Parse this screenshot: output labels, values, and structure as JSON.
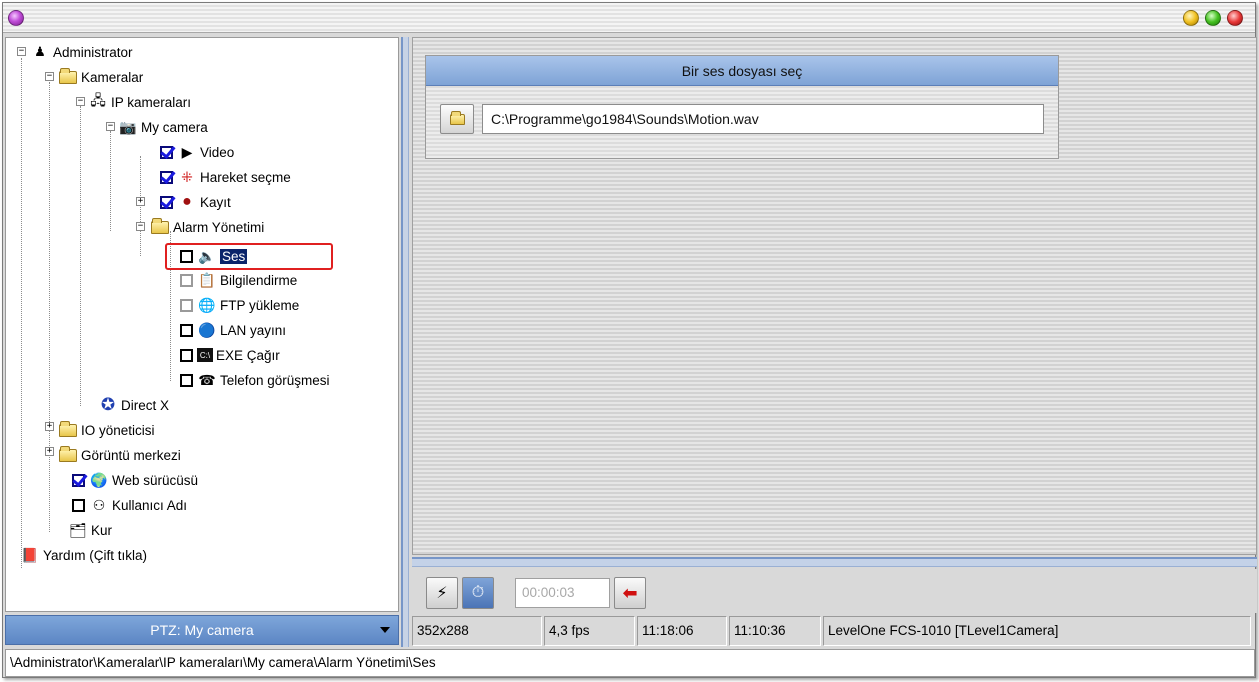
{
  "colors": {
    "accent": "#7ea3d6",
    "selection": "#0a246a",
    "highlight_box": "#e02020"
  },
  "tree": {
    "items": [
      {
        "label": "Administrator",
        "icon": "user-icon"
      },
      {
        "label": "Kameralar",
        "icon": "folder-icon"
      },
      {
        "label": "IP kameraları",
        "icon": "ip-camera-icon"
      },
      {
        "label": "My camera",
        "icon": "camera-icon"
      },
      {
        "label": "Video",
        "icon": "play-icon",
        "checked": true
      },
      {
        "label": "Hareket seçme",
        "icon": "motion-icon",
        "checked": true
      },
      {
        "label": "Kayıt",
        "icon": "record-icon",
        "checked": true
      },
      {
        "label": "Alarm Yönetimi",
        "icon": "folder-icon"
      },
      {
        "label": "Ses",
        "icon": "speaker-icon",
        "checked": false,
        "selected": true
      },
      {
        "label": "Bilgilendirme",
        "icon": "notify-icon",
        "checked": false
      },
      {
        "label": "FTP yükleme",
        "icon": "ftp-icon",
        "checked": false
      },
      {
        "label": "LAN yayını",
        "icon": "lan-icon",
        "checked": false
      },
      {
        "label": "EXE Çağır",
        "icon": "exe-icon",
        "checked": false
      },
      {
        "label": "Telefon görüşmesi",
        "icon": "phone-icon",
        "checked": false
      },
      {
        "label": "Direct X",
        "icon": "directx-icon"
      },
      {
        "label": "IO yöneticisi",
        "icon": "folder-icon"
      },
      {
        "label": "Görüntü merkezi",
        "icon": "folder-icon"
      },
      {
        "label": "Web sürücüsü",
        "icon": "globe-icon",
        "checked": true
      },
      {
        "label": "Kullanıcı Adı",
        "icon": "users-icon",
        "checked": false
      },
      {
        "label": "Kur",
        "icon": "setup-icon"
      },
      {
        "label": "Yardım (Çift tıkla)",
        "icon": "help-book-icon"
      }
    ]
  },
  "ptz": {
    "label": "PTZ: My camera"
  },
  "sound_panel": {
    "title": "Bir ses dosyası seç",
    "path_value": "C:\\Programme\\go1984\\Sounds\\Motion.wav"
  },
  "toolbar": {
    "time_value": "00:00:03"
  },
  "status": {
    "resolution": "352x288",
    "fps": "4,3 fps",
    "time1": "11:18:06",
    "time2": "11:10:36",
    "camera": "LevelOne FCS-1010 [TLevel1Camera]"
  },
  "path_bar": {
    "text": "\\Administrator\\Kameralar\\IP kameraları\\My camera\\Alarm Yönetimi\\Ses"
  }
}
